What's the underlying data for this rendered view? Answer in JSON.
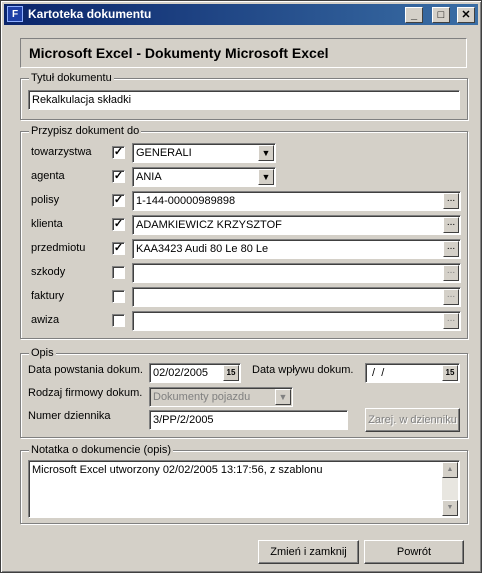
{
  "window": {
    "title": "Kartoteka dokumentu",
    "controls": {
      "minimize": "_",
      "maximize": "□",
      "close": "✕"
    }
  },
  "header": "Microsoft Excel - Dokumenty Microsoft Excel",
  "title_group": {
    "legend": "Tytuł dokumentu",
    "value": "Rekalkulacja składki"
  },
  "assign_group": {
    "legend": "Przypisz dokument do",
    "rows": [
      {
        "label": "towarzystwa",
        "checked": true,
        "value": "GENERALI"
      },
      {
        "label": "agenta",
        "checked": true,
        "value": "ANIA"
      },
      {
        "label": "polisy",
        "checked": true,
        "value": "1-144-00000989898"
      },
      {
        "label": "klienta",
        "checked": true,
        "value": "ADAMKIEWICZ KRZYSZTOF"
      },
      {
        "label": "przedmiotu",
        "checked": true,
        "value": "KAA3423 Audi 80 Le 80 Le"
      },
      {
        "label": "szkody",
        "checked": false,
        "value": ""
      },
      {
        "label": "faktury",
        "checked": false,
        "value": ""
      },
      {
        "label": "awiza",
        "checked": false,
        "value": ""
      }
    ],
    "check_mark": "✓",
    "dropdown_arrow": "▼",
    "browse_label": "..."
  },
  "opis_group": {
    "legend": "Opis",
    "created_label": "Data powstania dokum.",
    "created_value": "02/02/2005",
    "received_label": "Data wpływu dokum.",
    "received_value": " /  /",
    "calendar_label": "15",
    "type_label": "Rodzaj firmowy dokum.",
    "type_value": "Dokumenty pojazdu",
    "journal_label": "Numer dziennika",
    "journal_value": "3/PP/2/2005",
    "register_button": "Zarej. w dzienniku"
  },
  "note_group": {
    "legend": "Notatka o dokumencie (opis)",
    "text": "Microsoft Excel utworzony 02/02/2005 13:17:56, z szablonu"
  },
  "buttons": {
    "save": "Zmień i zamknij",
    "back": "Powrót"
  }
}
